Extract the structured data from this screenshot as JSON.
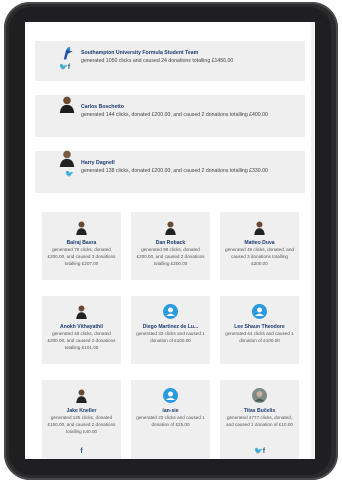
{
  "wide_cards": [
    {
      "name": "Southampton University Formula Student Team",
      "desc": "generated 1050 clicks and caused 24 donations totalling £1456.00",
      "avatar": "formula-car-logo-icon",
      "social": [
        "twitter",
        "facebook"
      ]
    },
    {
      "name": "Carlos Boschetto",
      "desc": "generated 144 clicks, donated £200.00, and caused 2 donations totalling £400.00",
      "avatar": "person-icon",
      "social": []
    },
    {
      "name": "Harry Dagnell",
      "desc": "generated 138 clicks, donated £200.00, and caused 2 donations totalling £330.00",
      "avatar": "person-icon",
      "social": [
        "twitter"
      ]
    }
  ],
  "small_cards": [
    {
      "name": "Balraj Basra",
      "desc": "generated 78 clicks, donated £200.00, and caused 3 donations totalling £207.00",
      "avatar": "person-icon"
    },
    {
      "name": "Dan Roback",
      "desc": "generated 98 clicks, donated £200.00, and caused 2 donations totalling £200.00",
      "avatar": "person-icon"
    },
    {
      "name": "Matteo Duva",
      "desc": "generated 49 clicks, donated, and caused 3 donations totalling £200.00",
      "avatar": "person-icon"
    },
    {
      "name": "Anokh Vithayathil",
      "desc": "generated 48 clicks, donated £200.00, and caused 2 donations totalling £101.00",
      "avatar": "person-icon"
    },
    {
      "name": "Diego Martinez de Lu...",
      "desc": "generated 33 clicks and caused 1 donation of £100.00",
      "avatar": "default-avatar-icon"
    },
    {
      "name": "Lee Shaun Theodore",
      "desc": "generated 44 clicks and caused 1 donation of £100.00",
      "avatar": "default-avatar-icon"
    },
    {
      "name": "Jake Kneller",
      "desc": "generated 125 clicks, donated £150.00, and caused 2 donations totalling £40.00",
      "avatar": "person-icon",
      "social": [
        "facebook"
      ]
    },
    {
      "name": "ian-sie",
      "desc": "generated 23 clicks and caused 1 donation of £25.00",
      "avatar": "default-avatar-icon"
    },
    {
      "name": "Titas Bučelis",
      "desc": "generated 4777 clicks, donated, and caused 1 donation of £10.00",
      "avatar": "photo-avatar-icon",
      "social": [
        "twitter",
        "facebook"
      ]
    }
  ],
  "social_glyphs": {
    "twitter": "𝕥",
    "facebook": "f"
  }
}
